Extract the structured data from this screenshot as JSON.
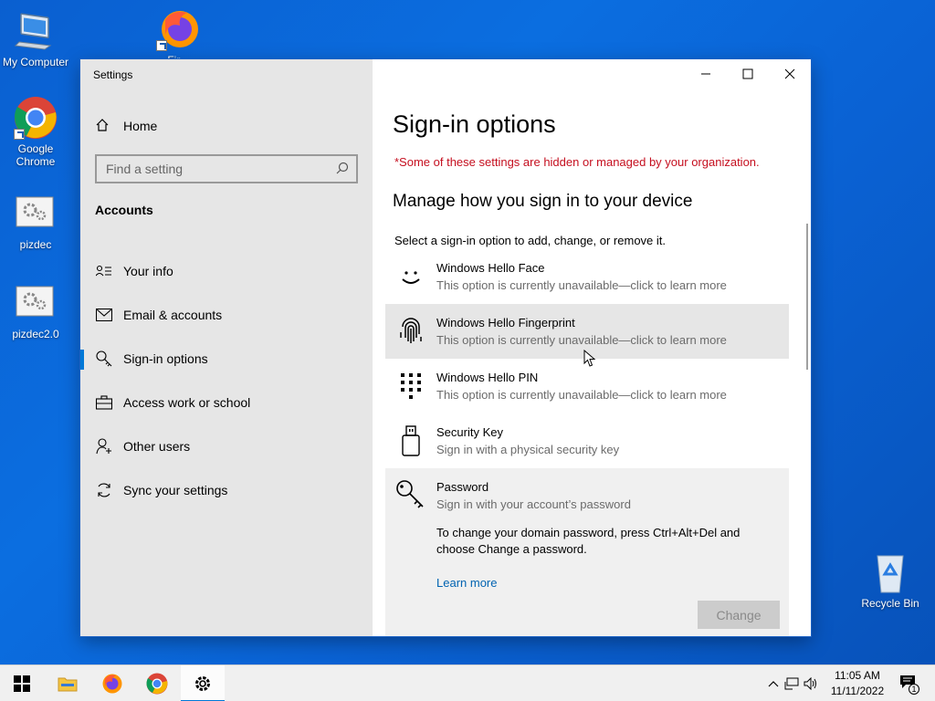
{
  "desktop": {
    "icons": [
      {
        "label": "My Computer"
      },
      {
        "label": "Fir..."
      },
      {
        "label": "Google Chrome"
      },
      {
        "label": "pizdec"
      },
      {
        "label": "pizdec2.0"
      },
      {
        "label": "Recycle Bin"
      }
    ]
  },
  "window": {
    "title": "Settings",
    "controls": {
      "minimize": "minimize",
      "maximize": "maximize",
      "close": "close"
    }
  },
  "sidebar": {
    "home_label": "Home",
    "search_placeholder": "Find a setting",
    "section": "Accounts",
    "items": [
      {
        "label": "Your info",
        "icon": "person-card-icon"
      },
      {
        "label": "Email & accounts",
        "icon": "mail-icon"
      },
      {
        "label": "Sign-in options",
        "icon": "key-icon",
        "active": true
      },
      {
        "label": "Access work or school",
        "icon": "briefcase-icon"
      },
      {
        "label": "Other users",
        "icon": "person-add-icon"
      },
      {
        "label": "Sync your settings",
        "icon": "sync-icon"
      }
    ]
  },
  "main": {
    "title": "Sign-in options",
    "managed_notice": "*Some of these settings are hidden or managed by your organization.",
    "subheading": "Manage how you sign in to your device",
    "instruction": "Select a sign-in option to add, change, or remove it.",
    "options": [
      {
        "title": "Windows Hello Face",
        "subtitle": "This option is currently unavailable—click to learn more",
        "icon": "face-icon"
      },
      {
        "title": "Windows Hello Fingerprint",
        "subtitle": "This option is currently unavailable—click to learn more",
        "icon": "fingerprint-icon"
      },
      {
        "title": "Windows Hello PIN",
        "subtitle": "This option is currently unavailable—click to learn more",
        "icon": "pin-keypad-icon"
      },
      {
        "title": "Security Key",
        "subtitle": "Sign in with a physical security key",
        "icon": "usb-key-icon"
      },
      {
        "title": "Password",
        "subtitle": "Sign in with your account’s password",
        "icon": "password-key-icon"
      }
    ],
    "password_note": "To change your domain password, press Ctrl+Alt+Del and choose Change a password.",
    "learn_more": "Learn more",
    "change_button": "Change"
  },
  "taskbar": {
    "pinned": [
      "start",
      "file-explorer",
      "firefox",
      "chrome",
      "settings"
    ],
    "time": "11:05 AM",
    "date": "11/11/2022",
    "notification_count": "1"
  },
  "colors": {
    "accent": "#0078d7",
    "managed_text": "#c50f1f",
    "link": "#0063b1",
    "desktop": "#0b6ee0"
  }
}
